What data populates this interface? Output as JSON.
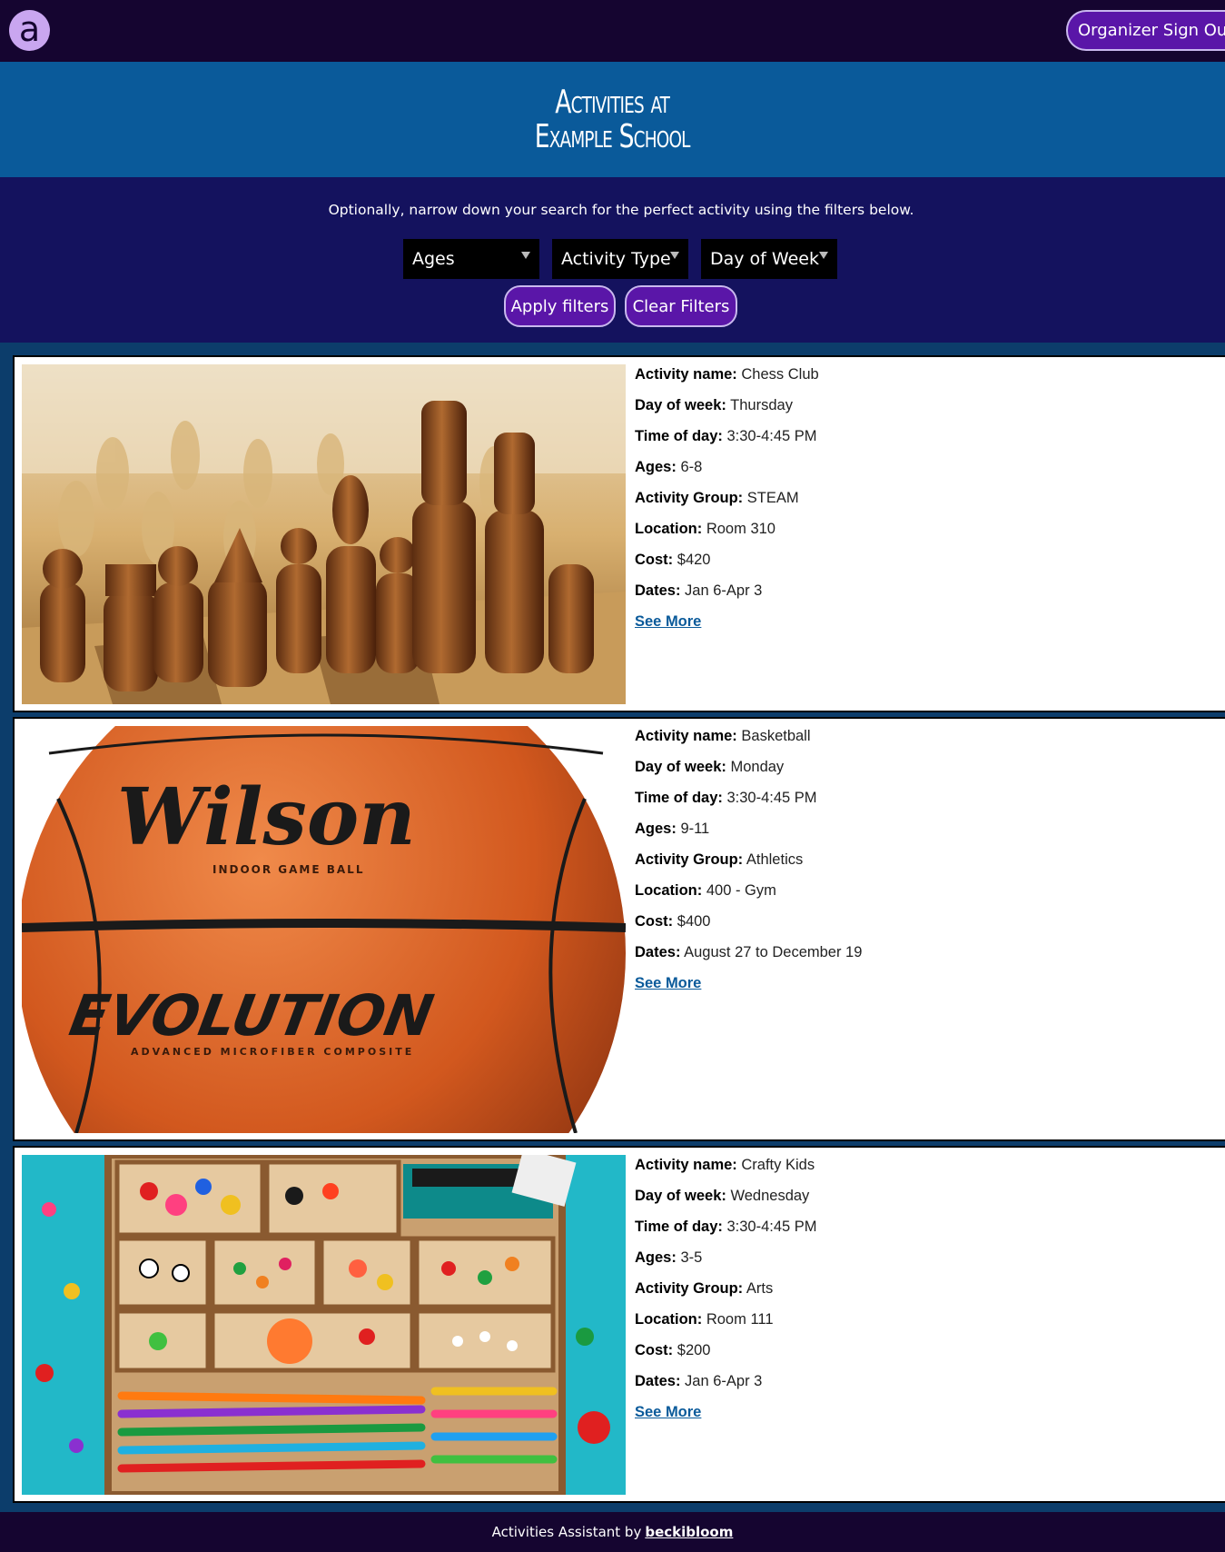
{
  "header": {
    "logo_letter": "a",
    "signout_label": "Organizer Sign Out"
  },
  "banner": {
    "title_line1": "Activities at",
    "title_line2": "Example School"
  },
  "filters": {
    "intro": "Optionally, narrow down your search for the perfect activity using the filters below.",
    "ages_label": "Ages",
    "type_label": "Activity Type",
    "day_label": "Day of Week",
    "apply_label": "Apply filters",
    "clear_label": "Clear Filters"
  },
  "labels": {
    "name": "Activity name:",
    "day": "Day of week:",
    "time": "Time of day:",
    "ages": "Ages:",
    "group": "Activity Group:",
    "location": "Location:",
    "cost": "Cost:",
    "dates": "Dates:",
    "see_more": "See More"
  },
  "activities": [
    {
      "name": "Chess Club",
      "day": "Thursday",
      "time": "3:30-4:45 PM",
      "ages": "6-8",
      "group": "STEAM",
      "location": "Room 310",
      "cost": "$420",
      "dates": "Jan 6-Apr 3",
      "image": "chess-photo"
    },
    {
      "name": "Basketball",
      "day": "Monday",
      "time": "3:30-4:45 PM",
      "ages": "9-11",
      "group": "Athletics",
      "location": "400 - Gym",
      "cost": "$400",
      "dates": "August 27 to December 19",
      "image": "basketball-photo",
      "image_text": {
        "brand": "Wilson",
        "subtitle": "INDOOR GAME BALL",
        "model": "EVOLUTION",
        "tagline": "ADVANCED MICROFIBER COMPOSITE"
      }
    },
    {
      "name": "Crafty Kids",
      "day": "Wednesday",
      "time": "3:30-4:45 PM",
      "ages": "3-5",
      "group": "Arts",
      "location": "Room 111",
      "cost": "$200",
      "dates": "Jan 6-Apr 3",
      "image": "craft-supplies-photo"
    }
  ],
  "footer": {
    "text": "Activities Assistant by",
    "link": "beckibloom"
  }
}
